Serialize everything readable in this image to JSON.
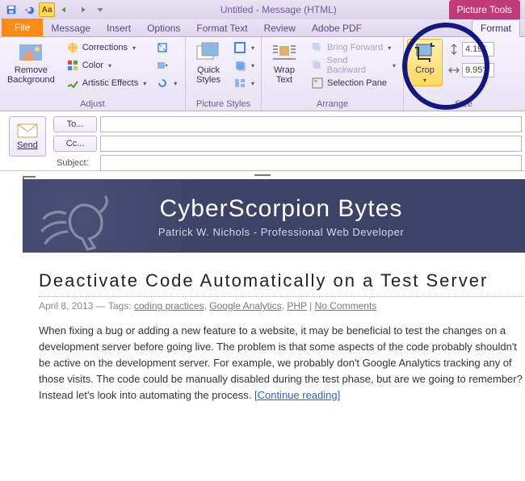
{
  "titlebar": {
    "title": "Untitled - Message (HTML)",
    "context_tab": "Picture Tools"
  },
  "tabs": {
    "file": "File",
    "items": [
      "Message",
      "Insert",
      "Options",
      "Format Text",
      "Review",
      "Adobe PDF"
    ],
    "format": "Format"
  },
  "ribbon": {
    "remove_bg": "Remove\nBackground",
    "corrections": "Corrections",
    "color": "Color",
    "artistic": "Artistic Effects",
    "adjust_label": "Adjust",
    "quick_styles": "Quick\nStyles",
    "picture_styles_label": "Picture Styles",
    "wrap_text": "Wrap\nText",
    "bring_forward": "Bring Forward",
    "send_backward": "Send Backward",
    "selection_pane": "Selection Pane",
    "arrange_label": "Arrange",
    "crop": "Crop",
    "size_label": "Size",
    "height": "4.19\"",
    "width": "9.95\""
  },
  "compose": {
    "send": "Send",
    "to": "To...",
    "cc": "Cc...",
    "subject": "Subject:",
    "to_value": "",
    "cc_value": "",
    "subject_value": ""
  },
  "content": {
    "banner_title": "CyberScorpion Bytes",
    "banner_sub": "Patrick W. Nichols - Professional Web Developer",
    "article_title": "Deactivate Code Automatically on a Test Server",
    "meta_date": "April 8, 2013",
    "meta_tags_label": "Tags:",
    "meta_tag1": "coding practices",
    "meta_tag2": "Google Analytics",
    "meta_tag3": "PHP",
    "meta_comments": "No Comments",
    "body": "When fixing a bug or adding a new feature to a website, it may be beneficial to test the changes on a development server before going live. The problem is that some aspects of the code probably shouldn't be active on the development server. For example, we probably don't Google Analytics tracking any of those visits. The code could be manually disabled during the test phase, but are we going to remember? Instead let's look into automating the process.",
    "continue": "[Continue reading]"
  }
}
